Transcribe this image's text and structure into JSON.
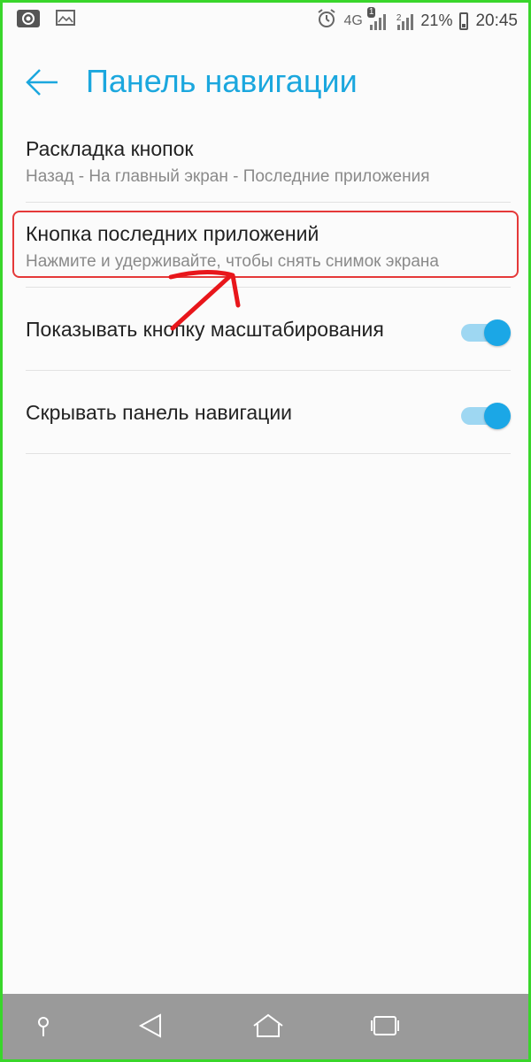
{
  "status_bar": {
    "network": "4G",
    "sim1_badge": "1",
    "sim2_number": "2",
    "battery": "21%",
    "time": "20:45",
    "icons": [
      "screen-record-icon",
      "gallery-icon",
      "alarm-icon",
      "signal-icon",
      "battery-icon"
    ]
  },
  "header": {
    "title": "Панель навигации",
    "accent_color": "#1ba7de"
  },
  "settings": {
    "items": [
      {
        "title": "Раскладка кнопок",
        "subtitle": "Назад - На главный экран - Последние приложения"
      },
      {
        "title": "Кнопка последних приложений",
        "subtitle": "Нажмите и удерживайте, чтобы снять снимок экрана"
      },
      {
        "title": "Показывать кнопку масштабирования",
        "toggle_on": true
      },
      {
        "title": "Скрывать панель навигации",
        "toggle_on": true
      }
    ]
  },
  "annotation": {
    "highlight_color": "#e53939"
  },
  "nav_bar": {
    "buttons": [
      "pin-icon",
      "back-icon",
      "home-icon",
      "recents-icon"
    ]
  }
}
